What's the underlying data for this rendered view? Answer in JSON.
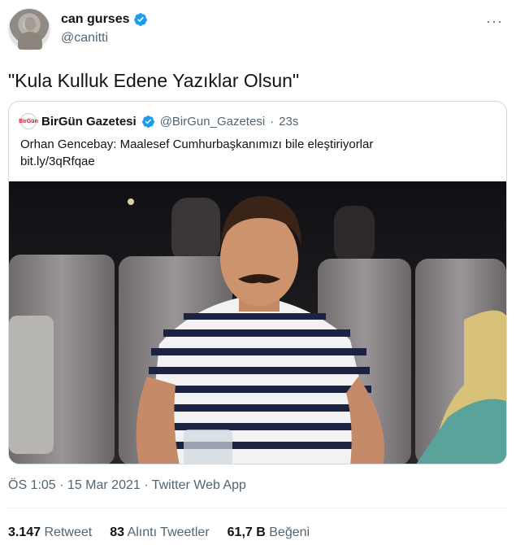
{
  "author": {
    "display_name": "can gurses",
    "handle": "@canitti"
  },
  "tweet": {
    "text": "\"Kula Kulluk Edene Yazıklar Olsun\""
  },
  "quoted_tweet": {
    "logo_text": "BirGün",
    "display_name": "BirGün Gazetesi",
    "handle": "@BirGun_Gazetesi",
    "separator": "·",
    "time": "23s",
    "text": "Orhan Gencebay: Maalesef Cumhurbaşkanımızı bile eleştiriyorlar",
    "link": "bit.ly/3qRfqae"
  },
  "meta": {
    "timestamp": "ÖS 1:05 · 15 Mar 2021 · Twitter Web App"
  },
  "stats": {
    "retweets_count": "3.147",
    "retweets_label": "Retweet",
    "quotes_count": "83",
    "quotes_label": "Alıntı Tweetler",
    "likes_count": "61,7 B",
    "likes_label": "Beğeni"
  },
  "colors": {
    "verified": "#1d9bf0",
    "secondary_text": "#536471"
  }
}
